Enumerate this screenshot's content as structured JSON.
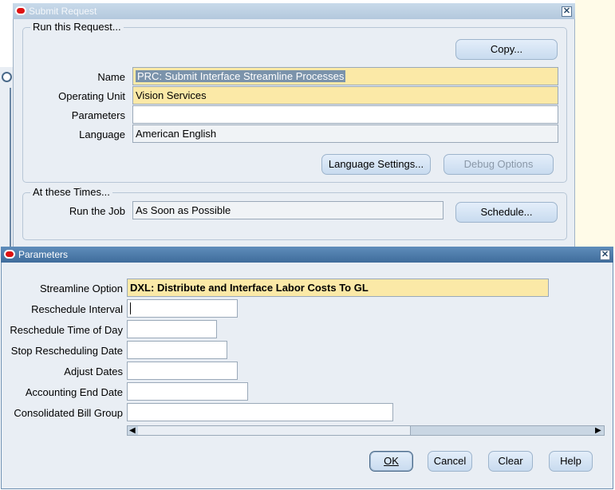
{
  "submit_request": {
    "title": "Submit Request",
    "run_group": {
      "label": "Run this Request...",
      "copy_button": "Copy...",
      "name_label": "Name",
      "name_value": "PRC: Submit Interface Streamline Processes",
      "operating_unit_label": "Operating Unit",
      "operating_unit_value": "Vision Services",
      "parameters_label": "Parameters",
      "parameters_value": "",
      "language_label": "Language",
      "language_value": "American English",
      "language_settings_button": "Language Settings...",
      "debug_options_button": "Debug Options"
    },
    "times_group": {
      "label": "At these Times...",
      "run_job_label": "Run the Job",
      "run_job_value": "As Soon as Possible",
      "schedule_button": "Schedule..."
    }
  },
  "parameters": {
    "title": "Parameters",
    "streamline_option_label": "Streamline Option",
    "streamline_option_value": "DXL: Distribute and Interface Labor Costs To GL",
    "reschedule_interval_label": "Reschedule Interval",
    "reschedule_time_label": "Reschedule Time of Day",
    "stop_rescheduling_label": "Stop Rescheduling Date",
    "adjust_dates_label": "Adjust Dates",
    "accounting_end_date_label": "Accounting End Date",
    "consolidated_bill_group_label": "Consolidated Bill Group",
    "buttons": {
      "ok": "OK",
      "cancel": "Cancel",
      "clear": "Clear",
      "help": "Help"
    }
  },
  "icons": {
    "close": "close-icon",
    "oracle": "oracle-logo-icon"
  }
}
